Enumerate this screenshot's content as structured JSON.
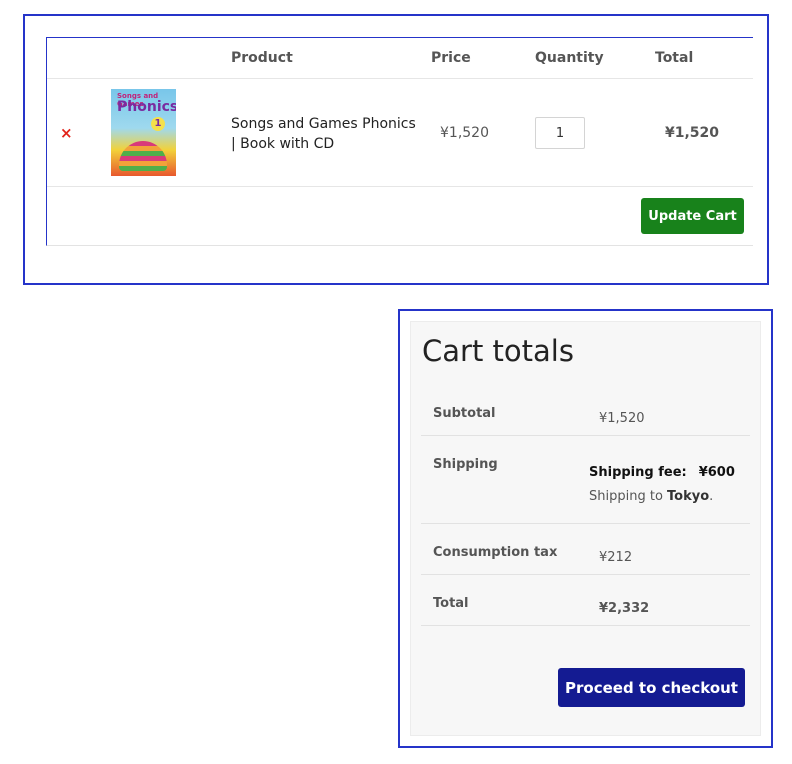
{
  "cart": {
    "headers": {
      "product": "Product",
      "price": "Price",
      "quantity": "Quantity",
      "total": "Total"
    },
    "remove_icon": "×",
    "item": {
      "name": "Songs and Games Phonics | Book with CD",
      "price": "¥1,520",
      "quantity": "1",
      "total": "¥1,520",
      "thumbnail": {
        "top_text": "Songs and Games",
        "title": "Phonics",
        "number": "1"
      }
    },
    "update_label": "Update Cart"
  },
  "totals": {
    "title": "Cart totals",
    "subtotal_label": "Subtotal",
    "subtotal_value": "¥1,520",
    "shipping_label": "Shipping",
    "shipping_fee_label": "Shipping fee:",
    "shipping_fee_value": "¥600",
    "shipping_to_prefix": "Shipping to ",
    "shipping_to_place": "Tokyo",
    "shipping_to_suffix": ".",
    "tax_label": "Consumption tax",
    "tax_value": "¥212",
    "total_label": "Total",
    "total_value": "¥2,332",
    "checkout_label": "Proceed to checkout"
  },
  "colors": {
    "panel_border": "#2534c9",
    "update_button": "#18821b",
    "checkout_button": "#141b92",
    "remove_icon": "#e2231a"
  }
}
